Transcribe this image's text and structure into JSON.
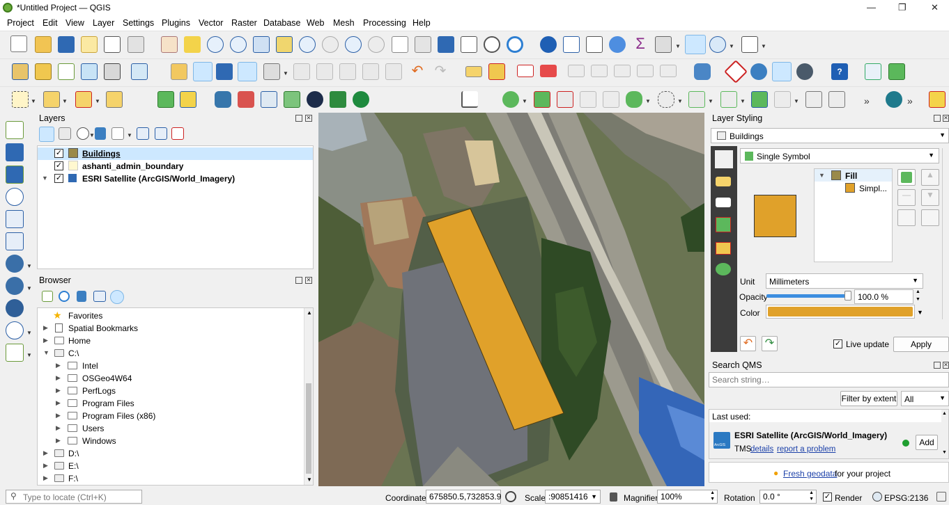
{
  "window": {
    "title": "*Untitled Project — QGIS",
    "minimize": "—",
    "maximize": "❐",
    "close": "✕"
  },
  "menu": [
    "Project",
    "Edit",
    "View",
    "Layer",
    "Settings",
    "Plugins",
    "Vector",
    "Raster",
    "Database",
    "Web",
    "Mesh",
    "Processing",
    "Help"
  ],
  "layers_panel": {
    "title": "Layers",
    "items": [
      {
        "name": "Buildings",
        "checked": "✓",
        "bold": true,
        "selected": true
      },
      {
        "name": "ashanti_admin_boundary",
        "checked": "✓"
      },
      {
        "name": "ESRI Satellite (ArcGIS/World_Imagery)",
        "checked": "✓"
      }
    ]
  },
  "browser_panel": {
    "title": "Browser",
    "items": [
      {
        "label": "Favorites",
        "icon": "star-icon"
      },
      {
        "label": "Spatial Bookmarks",
        "icon": "bookmark-icon"
      },
      {
        "label": "Home",
        "icon": "folder-icon"
      },
      {
        "label": "C:\\",
        "icon": "drive-icon"
      },
      {
        "label": "Intel",
        "icon": "folder-icon"
      },
      {
        "label": "OSGeo4W64",
        "icon": "folder-icon"
      },
      {
        "label": "PerfLogs",
        "icon": "folder-icon"
      },
      {
        "label": "Program Files",
        "icon": "folder-icon"
      },
      {
        "label": "Program Files (x86)",
        "icon": "folder-icon"
      },
      {
        "label": "Users",
        "icon": "folder-icon"
      },
      {
        "label": "Windows",
        "icon": "folder-icon"
      },
      {
        "label": "D:\\",
        "icon": "drive-icon"
      },
      {
        "label": "E:\\",
        "icon": "drive-icon"
      },
      {
        "label": "F:\\",
        "icon": "drive-icon"
      }
    ]
  },
  "layer_styling": {
    "title": "Layer Styling",
    "layer": "Buildings",
    "renderer": "Single Symbol",
    "tree": {
      "root": "Fill",
      "child": "Simpl..."
    },
    "fill_color": "#e0a12a",
    "unit_label": "Unit",
    "unit_value": "Millimeters",
    "opacity_label": "Opacity",
    "opacity_value": "100.0 %",
    "opacity_fraction": 1.0,
    "color_label": "Color",
    "live_update_label": "Live update",
    "live_update_checked": "✓",
    "apply_label": "Apply"
  },
  "qms": {
    "title": "Search QMS",
    "search_placeholder": "Search string…",
    "filter_button": "Filter by extent",
    "filter_select": "All",
    "last_used_label": "Last used:",
    "service_name": "ESRI Satellite (ArcGIS/World_Imagery)",
    "service_type": "TMS",
    "details_link": "details",
    "report_link": "report a problem",
    "add_button": "Add",
    "arcgis_label": "ArcGIS",
    "fresh_link": "Fresh geodata",
    "fresh_suffix": "for your project",
    "status_color": "#1e9e2f"
  },
  "statusbar": {
    "locator_placeholder": "Type to locate (Ctrl+K)",
    "coordinate_label": "Coordinate",
    "coordinate_value": "675850.5,732853.9",
    "scale_label": "Scale",
    "scale_value": ":90851416",
    "magnifier_label": "Magnifier",
    "magnifier_value": "100%",
    "rotation_label": "Rotation",
    "rotation_value": "0.0 °",
    "render_label": "Render",
    "render_checked": "✓",
    "crs": "EPSG:2136"
  },
  "colors": {
    "accent": "#e0a12a",
    "link": "#1a3fa8",
    "selection": "#cde8ff",
    "qgis_green": "#6cad3c"
  }
}
